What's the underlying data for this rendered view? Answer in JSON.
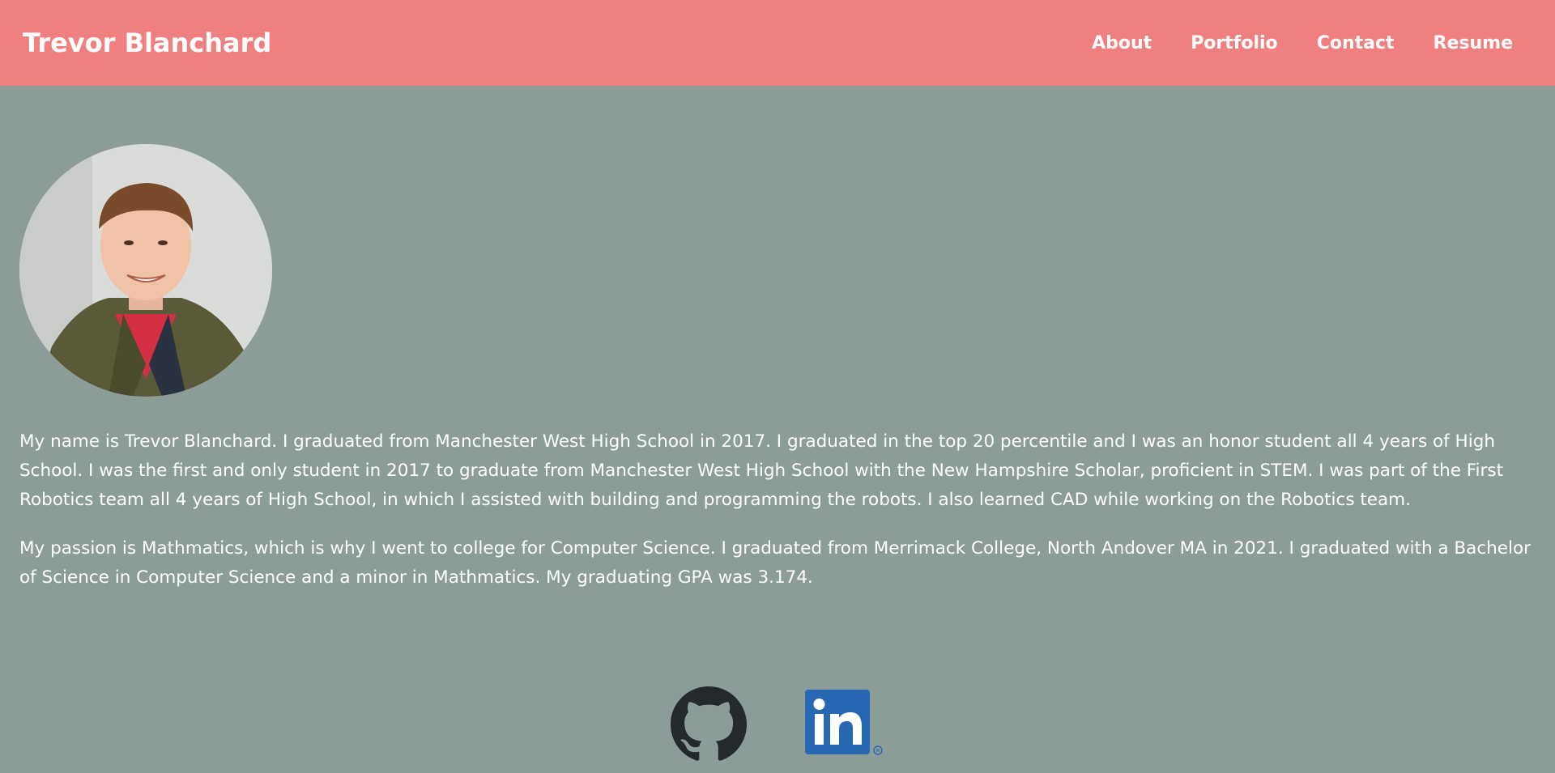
{
  "header": {
    "brand": "Trevor Blanchard",
    "nav": [
      {
        "label": "About"
      },
      {
        "label": "Portfolio"
      },
      {
        "label": "Contact"
      },
      {
        "label": "Resume"
      }
    ],
    "bg_color": "#f08080"
  },
  "about": {
    "photo_alt": "Trevor Blanchard headshot",
    "paragraphs": [
      "My name is Trevor Blanchard. I graduated from Manchester West High School in 2017. I graduated in the top 20 percentile and I was an honor student all 4 years of High School. I was the first and only student in 2017 to graduate from Manchester West High School with the New Hampshire Scholar, proficient in STEM. I was part of the First Robotics team all 4 years of High School, in which I assisted with building and programming the robots. I also learned CAD while working on the Robotics team.",
      "My passion is Mathmatics, which is why I went to college for Computer Science. I graduated from Merrimack College, North Andover MA in 2021. I graduated with a Bachelor of Science in Computer Science and a minor in Mathmatics. My graduating GPA was 3.174."
    ]
  },
  "footer": {
    "links": [
      {
        "icon": "github-icon"
      },
      {
        "icon": "linkedin-icon"
      }
    ]
  },
  "colors": {
    "page_bg": "#8c9c99",
    "header_bg": "#f08080",
    "text": "#ffffff",
    "github": "#24292e",
    "linkedin": "#2867b2"
  }
}
